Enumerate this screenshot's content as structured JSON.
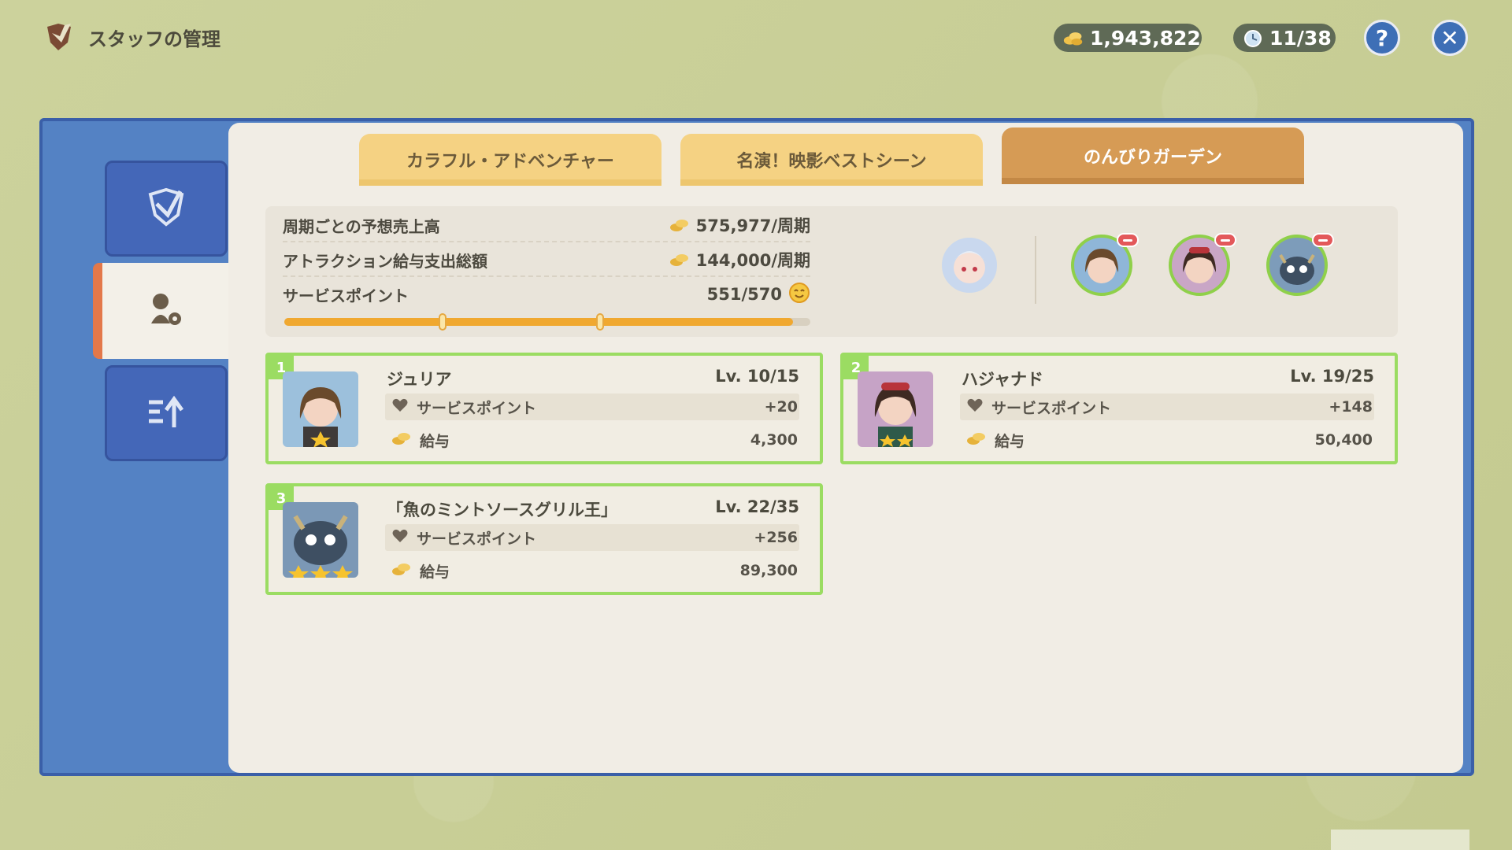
{
  "header": {
    "title": "スタッフの管理",
    "mora": "1,943,822",
    "timer": "11/38"
  },
  "tabs": [
    {
      "label": "カラフル・アドベンチャー",
      "active": false
    },
    {
      "label": "名演！映影ベストシーン",
      "active": false
    },
    {
      "label": "のんびりガーデン",
      "active": true
    }
  ],
  "summary": {
    "expected_sales_label": "周期ごとの予想売上高",
    "expected_sales_value": "575,977/周期",
    "salary_total_label": "アトラクション給与支出総額",
    "salary_total_value": "144,000/周期",
    "service_points_label": "サービスポイント",
    "service_points_value": "551/570",
    "service_progress": 0.967
  },
  "staff": [
    {
      "number": "1",
      "name": "ジュリア",
      "level": "Lv. 10/15",
      "service_label": "サービスポイント",
      "service_value": "+20",
      "salary_label": "給与",
      "salary_value": "4,300",
      "stars": 1
    },
    {
      "number": "2",
      "name": "ハジャナド",
      "level": "Lv. 19/25",
      "service_label": "サービスポイント",
      "service_value": "+148",
      "salary_label": "給与",
      "salary_value": "50,400",
      "stars": 2
    },
    {
      "number": "3",
      "name": "「魚のミントソースグリル王」",
      "level": "Lv. 22/35",
      "service_label": "サービスポイント",
      "service_value": "+256",
      "salary_label": "給与",
      "salary_value": "89,300",
      "stars": 3
    }
  ],
  "icons": {
    "header_logo": "quill-shield-icon",
    "mora": "coin-stack-icon",
    "timer": "clock-icon",
    "help": "question-icon",
    "close": "close-icon"
  },
  "colors": {
    "accent_green": "#9bdc62",
    "tab_active": "#d69b55",
    "tab_inactive": "#f5d283",
    "frame_blue": "#5482c4"
  }
}
